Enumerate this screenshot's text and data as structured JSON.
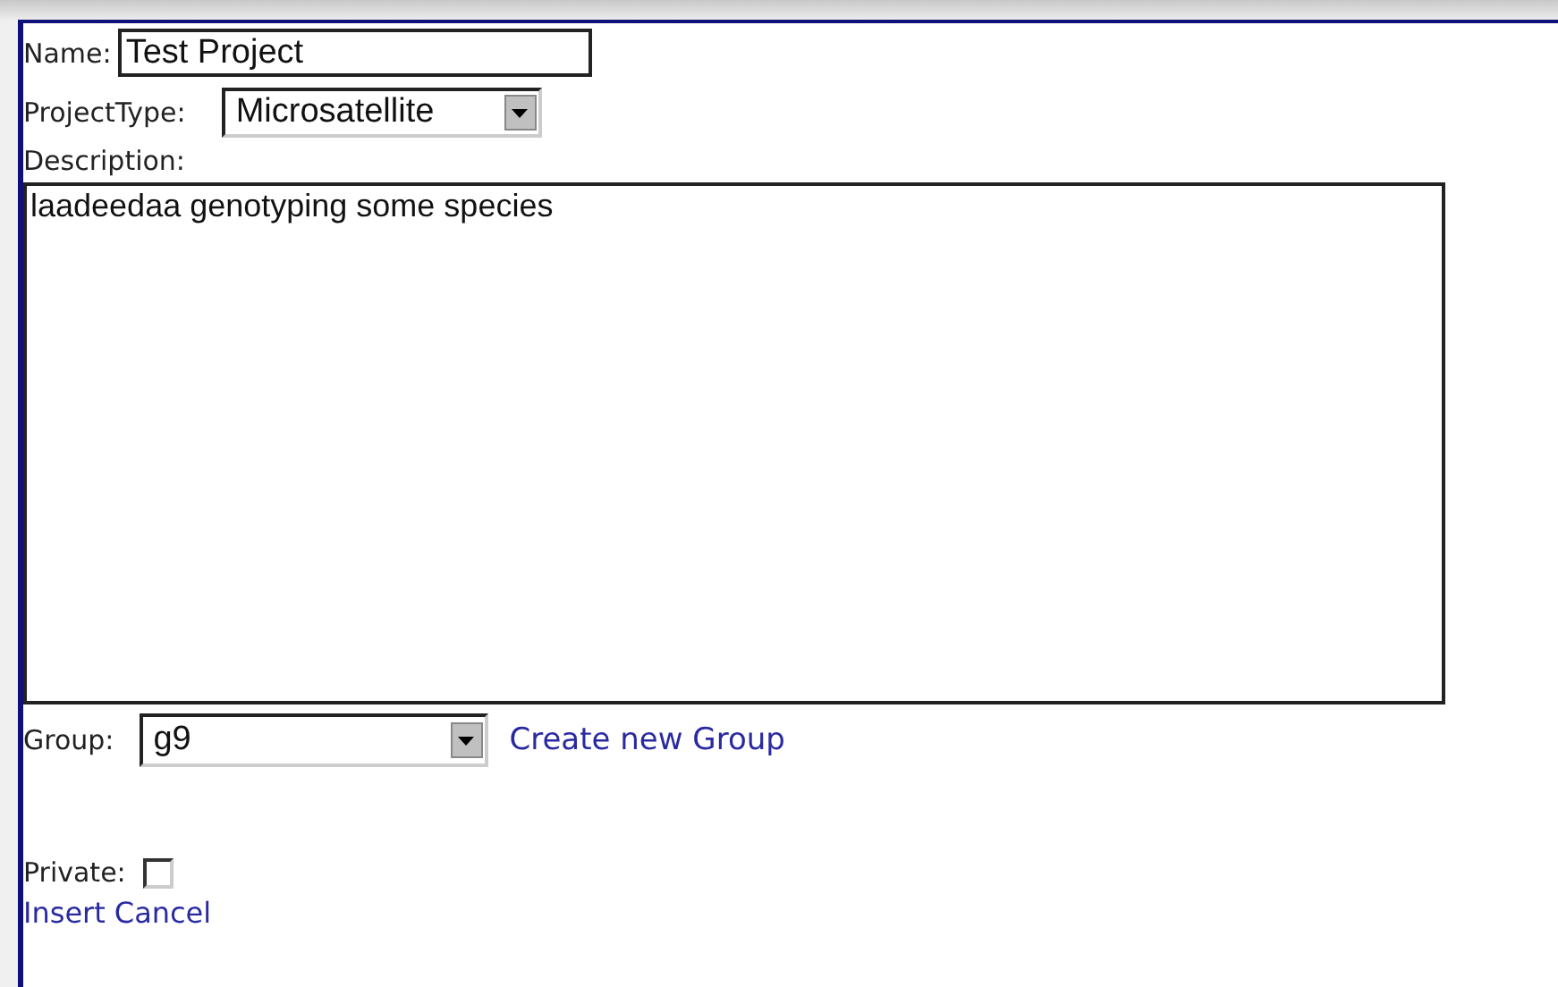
{
  "name": {
    "label": "Name:",
    "value": "Test Project"
  },
  "project_type": {
    "label": "ProjectType:",
    "value": "Microsatellite"
  },
  "description": {
    "label": "Description:",
    "value": "laadeedaa genotyping some species"
  },
  "group": {
    "label": "Group:",
    "value": "g9",
    "link": "Create new Group"
  },
  "private": {
    "label": "Private:",
    "checked": false
  },
  "actions": [
    "Insert",
    "Cancel"
  ]
}
